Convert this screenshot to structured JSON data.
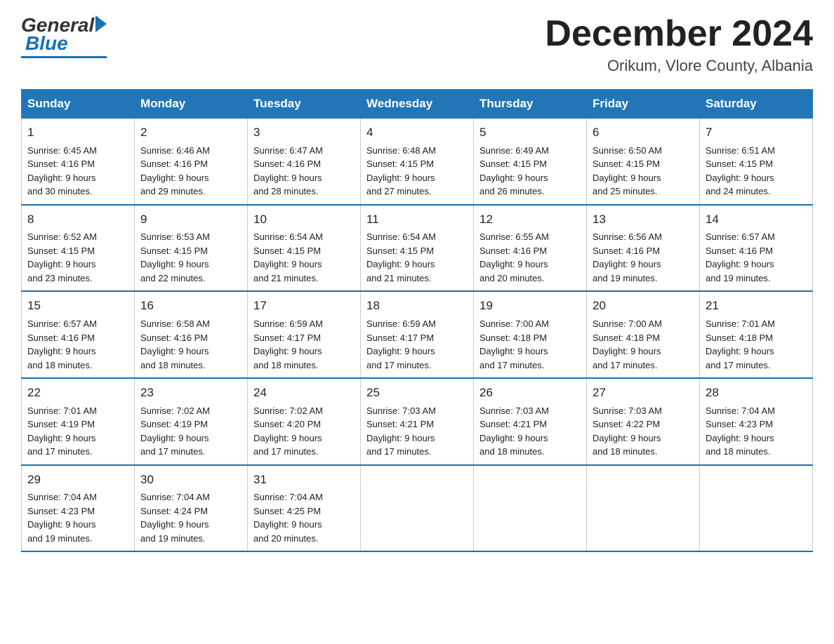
{
  "header": {
    "logo": {
      "general": "General",
      "blue": "Blue"
    },
    "title": "December 2024",
    "location": "Orikum, Vlore County, Albania"
  },
  "weekdays": [
    "Sunday",
    "Monday",
    "Tuesday",
    "Wednesday",
    "Thursday",
    "Friday",
    "Saturday"
  ],
  "weeks": [
    [
      {
        "day": "1",
        "sunrise": "6:45 AM",
        "sunset": "4:16 PM",
        "daylight": "9 hours and 30 minutes."
      },
      {
        "day": "2",
        "sunrise": "6:46 AM",
        "sunset": "4:16 PM",
        "daylight": "9 hours and 29 minutes."
      },
      {
        "day": "3",
        "sunrise": "6:47 AM",
        "sunset": "4:16 PM",
        "daylight": "9 hours and 28 minutes."
      },
      {
        "day": "4",
        "sunrise": "6:48 AM",
        "sunset": "4:15 PM",
        "daylight": "9 hours and 27 minutes."
      },
      {
        "day": "5",
        "sunrise": "6:49 AM",
        "sunset": "4:15 PM",
        "daylight": "9 hours and 26 minutes."
      },
      {
        "day": "6",
        "sunrise": "6:50 AM",
        "sunset": "4:15 PM",
        "daylight": "9 hours and 25 minutes."
      },
      {
        "day": "7",
        "sunrise": "6:51 AM",
        "sunset": "4:15 PM",
        "daylight": "9 hours and 24 minutes."
      }
    ],
    [
      {
        "day": "8",
        "sunrise": "6:52 AM",
        "sunset": "4:15 PM",
        "daylight": "9 hours and 23 minutes."
      },
      {
        "day": "9",
        "sunrise": "6:53 AM",
        "sunset": "4:15 PM",
        "daylight": "9 hours and 22 minutes."
      },
      {
        "day": "10",
        "sunrise": "6:54 AM",
        "sunset": "4:15 PM",
        "daylight": "9 hours and 21 minutes."
      },
      {
        "day": "11",
        "sunrise": "6:54 AM",
        "sunset": "4:15 PM",
        "daylight": "9 hours and 21 minutes."
      },
      {
        "day": "12",
        "sunrise": "6:55 AM",
        "sunset": "4:16 PM",
        "daylight": "9 hours and 20 minutes."
      },
      {
        "day": "13",
        "sunrise": "6:56 AM",
        "sunset": "4:16 PM",
        "daylight": "9 hours and 19 minutes."
      },
      {
        "day": "14",
        "sunrise": "6:57 AM",
        "sunset": "4:16 PM",
        "daylight": "9 hours and 19 minutes."
      }
    ],
    [
      {
        "day": "15",
        "sunrise": "6:57 AM",
        "sunset": "4:16 PM",
        "daylight": "9 hours and 18 minutes."
      },
      {
        "day": "16",
        "sunrise": "6:58 AM",
        "sunset": "4:16 PM",
        "daylight": "9 hours and 18 minutes."
      },
      {
        "day": "17",
        "sunrise": "6:59 AM",
        "sunset": "4:17 PM",
        "daylight": "9 hours and 18 minutes."
      },
      {
        "day": "18",
        "sunrise": "6:59 AM",
        "sunset": "4:17 PM",
        "daylight": "9 hours and 17 minutes."
      },
      {
        "day": "19",
        "sunrise": "7:00 AM",
        "sunset": "4:18 PM",
        "daylight": "9 hours and 17 minutes."
      },
      {
        "day": "20",
        "sunrise": "7:00 AM",
        "sunset": "4:18 PM",
        "daylight": "9 hours and 17 minutes."
      },
      {
        "day": "21",
        "sunrise": "7:01 AM",
        "sunset": "4:18 PM",
        "daylight": "9 hours and 17 minutes."
      }
    ],
    [
      {
        "day": "22",
        "sunrise": "7:01 AM",
        "sunset": "4:19 PM",
        "daylight": "9 hours and 17 minutes."
      },
      {
        "day": "23",
        "sunrise": "7:02 AM",
        "sunset": "4:19 PM",
        "daylight": "9 hours and 17 minutes."
      },
      {
        "day": "24",
        "sunrise": "7:02 AM",
        "sunset": "4:20 PM",
        "daylight": "9 hours and 17 minutes."
      },
      {
        "day": "25",
        "sunrise": "7:03 AM",
        "sunset": "4:21 PM",
        "daylight": "9 hours and 17 minutes."
      },
      {
        "day": "26",
        "sunrise": "7:03 AM",
        "sunset": "4:21 PM",
        "daylight": "9 hours and 18 minutes."
      },
      {
        "day": "27",
        "sunrise": "7:03 AM",
        "sunset": "4:22 PM",
        "daylight": "9 hours and 18 minutes."
      },
      {
        "day": "28",
        "sunrise": "7:04 AM",
        "sunset": "4:23 PM",
        "daylight": "9 hours and 18 minutes."
      }
    ],
    [
      {
        "day": "29",
        "sunrise": "7:04 AM",
        "sunset": "4:23 PM",
        "daylight": "9 hours and 19 minutes."
      },
      {
        "day": "30",
        "sunrise": "7:04 AM",
        "sunset": "4:24 PM",
        "daylight": "9 hours and 19 minutes."
      },
      {
        "day": "31",
        "sunrise": "7:04 AM",
        "sunset": "4:25 PM",
        "daylight": "9 hours and 20 minutes."
      },
      null,
      null,
      null,
      null
    ]
  ],
  "labels": {
    "sunrise": "Sunrise:",
    "sunset": "Sunset:",
    "daylight": "Daylight:"
  }
}
